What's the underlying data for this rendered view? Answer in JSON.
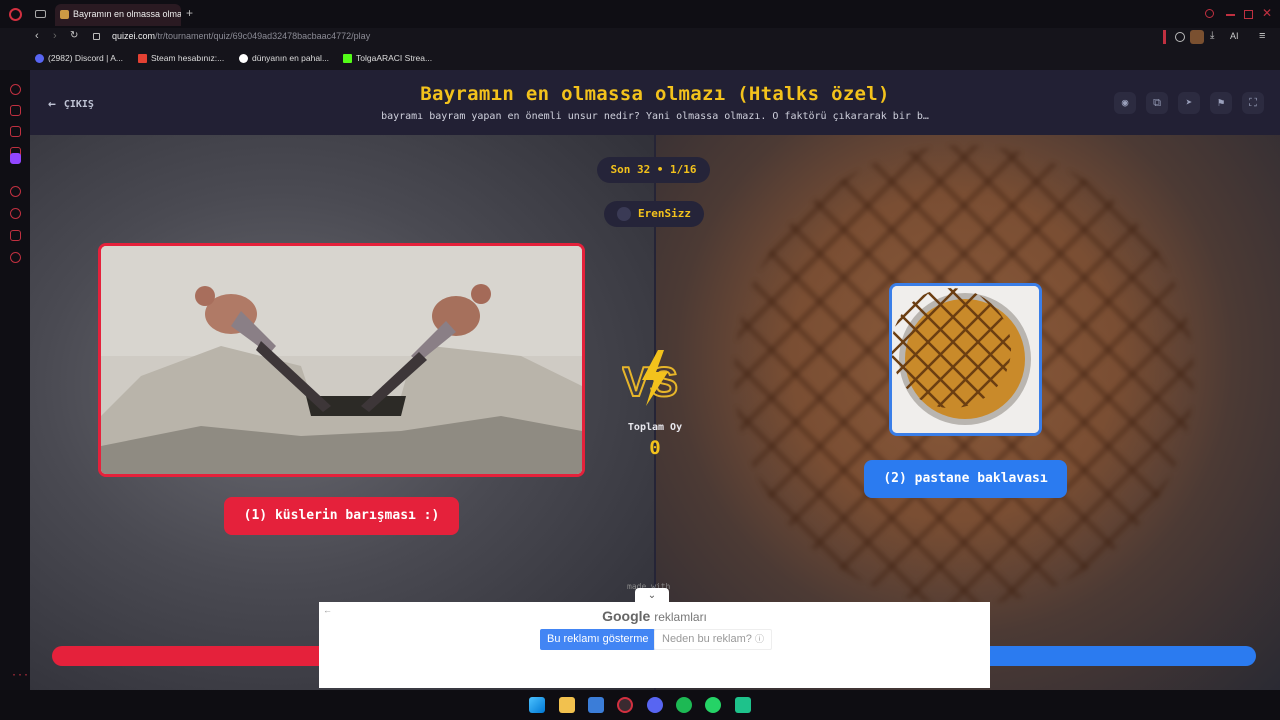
{
  "browser": {
    "tab_title": "Bayramın en olmassa olma",
    "url_domain": "quizei.com",
    "url_path": "/tr/tournament/quiz/69c049ad32478bacbaac4772/play",
    "ai_label": "AI",
    "bookmarks": [
      {
        "label": "(2982) Discord | A...",
        "color": "#5865f2"
      },
      {
        "label": "Steam hesabınız:...",
        "color": "#e34133"
      },
      {
        "label": "dünyanın en pahal...",
        "color": "#ffffff"
      },
      {
        "label": "TolgaARACI Strea...",
        "color": "#53fc18"
      }
    ]
  },
  "header": {
    "exit_label": "ÇIKIŞ",
    "title": "Bayramın en olmassa olmazı (Htalks özel)",
    "subtitle": "bayramı bayram yapan en önemli unsur nedir? Yani olmassa olmazı. O faktörü çıkararak bir b…",
    "icons": [
      "eye-icon",
      "share-icon",
      "send-icon",
      "flag-icon",
      "fullscreen-icon"
    ]
  },
  "round": {
    "label": "Son 32 • 1/16",
    "creator": "ErenSizz"
  },
  "options": {
    "left": {
      "label": "(1) küslerin barışması :)"
    },
    "right": {
      "label": "(2) pastane baklavası"
    }
  },
  "vs": {
    "text": "VS",
    "total_label": "Toplam Oy",
    "total_value": "0"
  },
  "ad": {
    "brand": "Google",
    "brand_suffix": "reklamları",
    "hide_button": "Bu reklamı gösterme",
    "why_button": "Neden bu reklam?",
    "peek_text": "made with"
  },
  "colors": {
    "accent_yellow": "#f3c21c",
    "left_red": "#e5213b",
    "right_blue": "#2b7bf0",
    "page_bg": "#1b1a26"
  }
}
